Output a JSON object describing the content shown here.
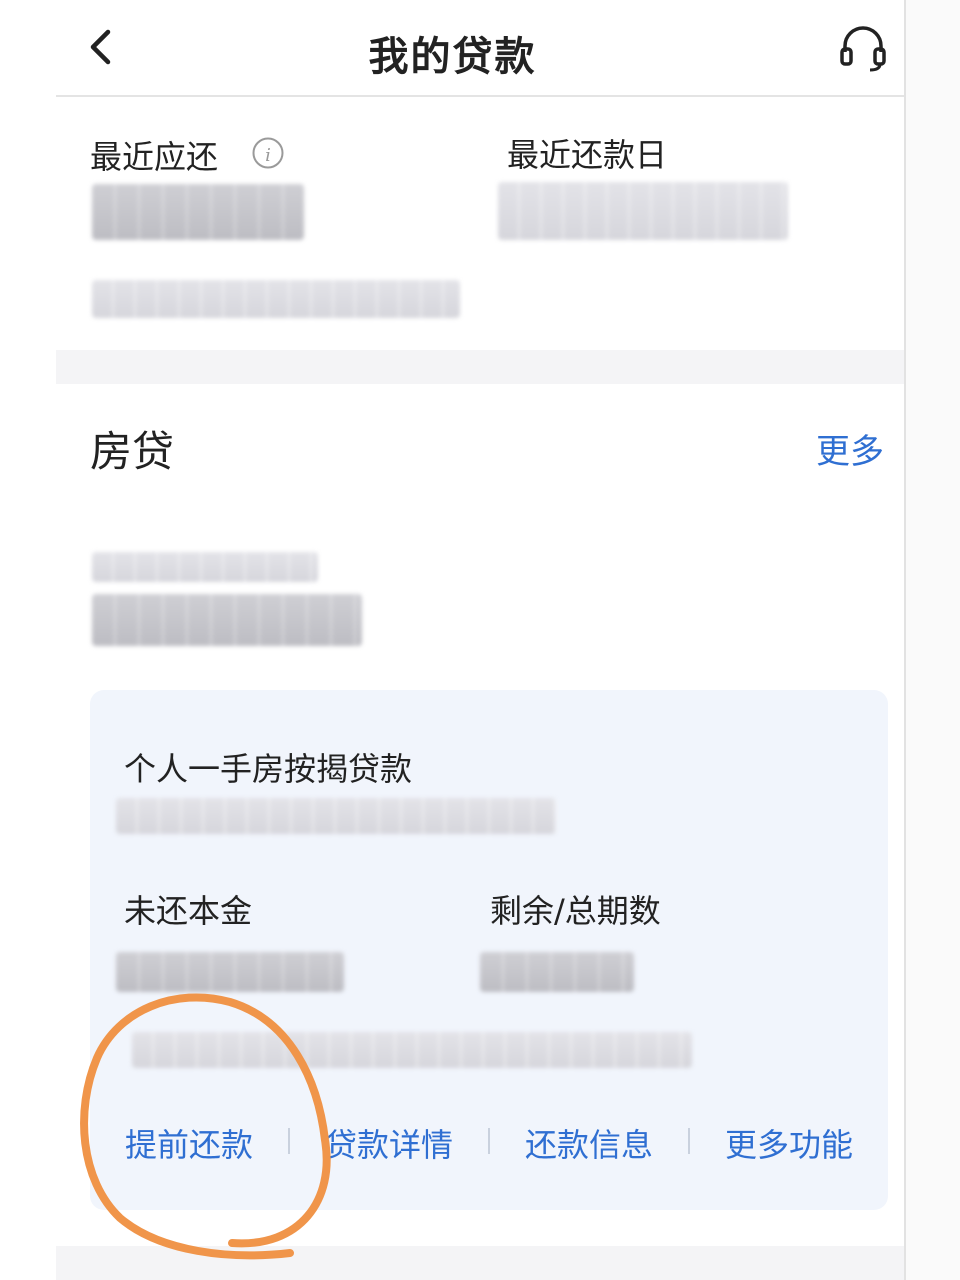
{
  "header": {
    "title": "我的贷款",
    "back_icon": "chevron-left-icon",
    "service_icon": "headset-icon"
  },
  "summary": {
    "recent_due_label": "最近应还",
    "info_icon": "info-icon",
    "recent_due_date_label": "最近还款日"
  },
  "mortgage": {
    "title": "房贷",
    "more_label": "更多",
    "loan_name": "个人一手房按揭贷款",
    "principal_label": "未还本金",
    "periods_label": "剩余/总期数",
    "actions": [
      "提前还款",
      "贷款详情",
      "还款信息",
      "更多功能"
    ]
  },
  "colors": {
    "link_blue": "#2f6fd2",
    "card_bg": "#f1f5fc",
    "annotation_orange": "#f0954a"
  }
}
